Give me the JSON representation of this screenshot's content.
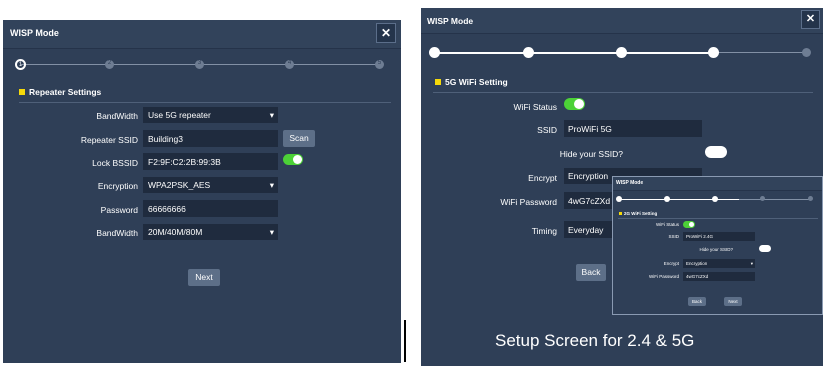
{
  "left": {
    "title": "WISP Mode",
    "close": "✕",
    "steps": [
      "1",
      "2",
      "3",
      "4",
      "5"
    ],
    "section": "Repeater Settings",
    "rows": {
      "bandwidth1": {
        "label": "BandWidth",
        "value": "Use 5G repeater"
      },
      "ssid": {
        "label": "Repeater SSID",
        "value": "Building3",
        "button": "Scan"
      },
      "bssid": {
        "label": "Lock BSSID",
        "value": "F2:9F:C2:2B:99:3B",
        "toggle": "on"
      },
      "encryption": {
        "label": "Encryption",
        "value": "WPA2PSK_AES"
      },
      "password": {
        "label": "Password",
        "value": "66666666"
      },
      "bandwidth2": {
        "label": "BandWidth",
        "value": "20M/40M/80M"
      }
    },
    "next": "Next"
  },
  "right": {
    "title": "WISP Mode",
    "close": "✕",
    "section": "5G WiFi Setting",
    "rows": {
      "wifi_status": {
        "label": "WiFi Status",
        "toggle": "on"
      },
      "ssid": {
        "label": "SSID",
        "value": "ProWiFi 5G"
      },
      "hide": {
        "label": "Hide your SSID?",
        "toggle": "off"
      },
      "encrypt": {
        "label": "Encrypt",
        "value": "Encryption"
      },
      "password": {
        "label": "WiFi Password",
        "value": "4wG7cZXd"
      },
      "timing": {
        "label": "Timing",
        "value": "Everyday"
      }
    },
    "back": "Back",
    "caption": "Setup Screen for 2.4 & 5G"
  },
  "inset": {
    "title": "WISP Mode",
    "section": "2G WiFi Setting",
    "rows": {
      "wifi_status": {
        "label": "WiFi Status",
        "toggle": "on"
      },
      "ssid": {
        "label": "SSID",
        "value": "ProWiFi 2.4G"
      },
      "hide": {
        "label": "Hide your SSID?",
        "toggle": "off"
      },
      "encrypt": {
        "label": "Encrypt",
        "value": "Encryption"
      },
      "password": {
        "label": "WiFi Password",
        "value": "4wG7cZXd"
      }
    },
    "back": "Back",
    "next": "Next"
  },
  "caret": "▾",
  "colors": {
    "panel": "#2f3f57",
    "field": "#1f2b3e",
    "toggle_on": "#4cd137",
    "section_marker": "#f5d90a",
    "button": "#5d6f88"
  }
}
